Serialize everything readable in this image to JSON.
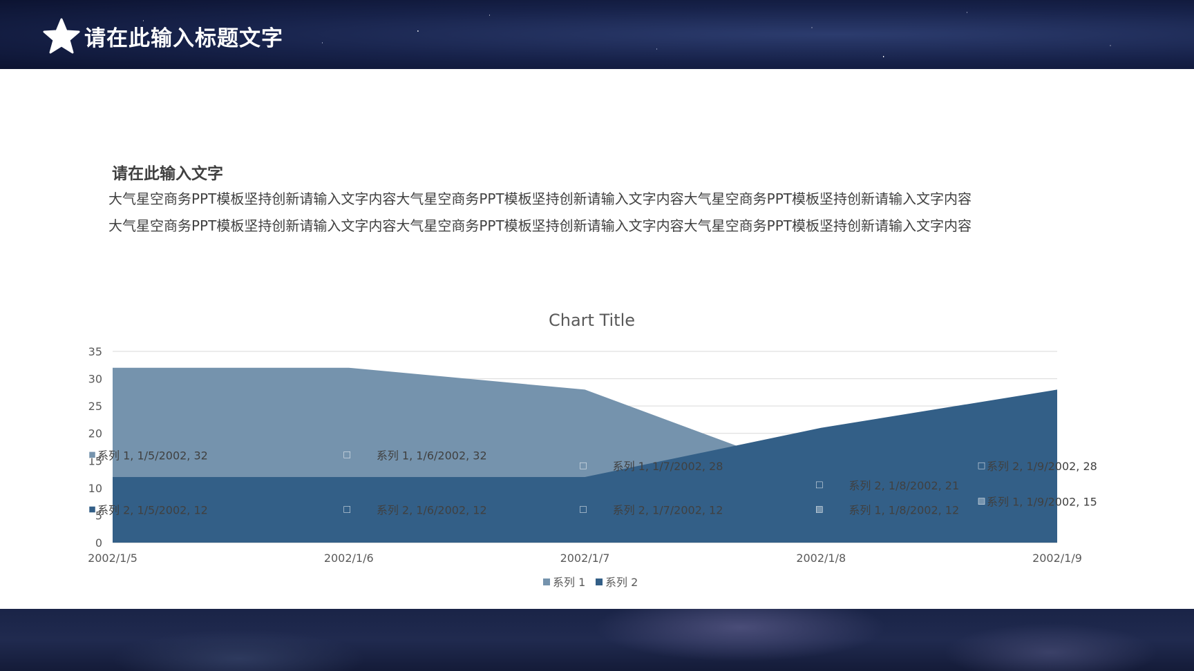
{
  "header": {
    "title": "请在此输入标题文字",
    "icon": "star-icon"
  },
  "content": {
    "heading": "请在此输入文字",
    "line1": "大气星空商务PPT模板坚持创新请输入文字内容大气星空商务PPT模板坚持创新请输入文字内容大气星空商务PPT模板坚持创新请输入文字内容",
    "line2": "大气星空商务PPT模板坚持创新请输入文字内容大气星空商务PPT模板坚持创新请输入文字内容大气星空商务PPT模板坚持创新请输入文字内容"
  },
  "chart_data": {
    "type": "area",
    "title": "Chart Title",
    "x": [
      "2002/1/5",
      "2002/1/6",
      "2002/1/7",
      "2002/1/8",
      "2002/1/9"
    ],
    "ylim": [
      0,
      35
    ],
    "yticks": [
      0,
      5,
      10,
      15,
      20,
      25,
      30,
      35
    ],
    "grid": true,
    "legend_position": "bottom",
    "series": [
      {
        "name": "系列 1",
        "color": "#7593ad",
        "values": [
          32,
          32,
          28,
          12,
          15
        ],
        "labels": [
          "系列 1, 1/5/2002, 32",
          "系列 1, 1/6/2002, 32",
          "系列 1, 1/7/2002, 28",
          "系列 1, 1/8/2002, 12",
          "系列 1, 1/9/2002, 15"
        ]
      },
      {
        "name": "系列 2",
        "color": "#335f87",
        "values": [
          12,
          12,
          12,
          21,
          28
        ],
        "labels": [
          "系列 2, 1/5/2002, 12",
          "系列 2, 1/6/2002, 12",
          "系列 2, 1/7/2002, 12",
          "系列 2, 1/8/2002, 21",
          "系列 2, 1/9/2002, 28"
        ]
      }
    ]
  }
}
